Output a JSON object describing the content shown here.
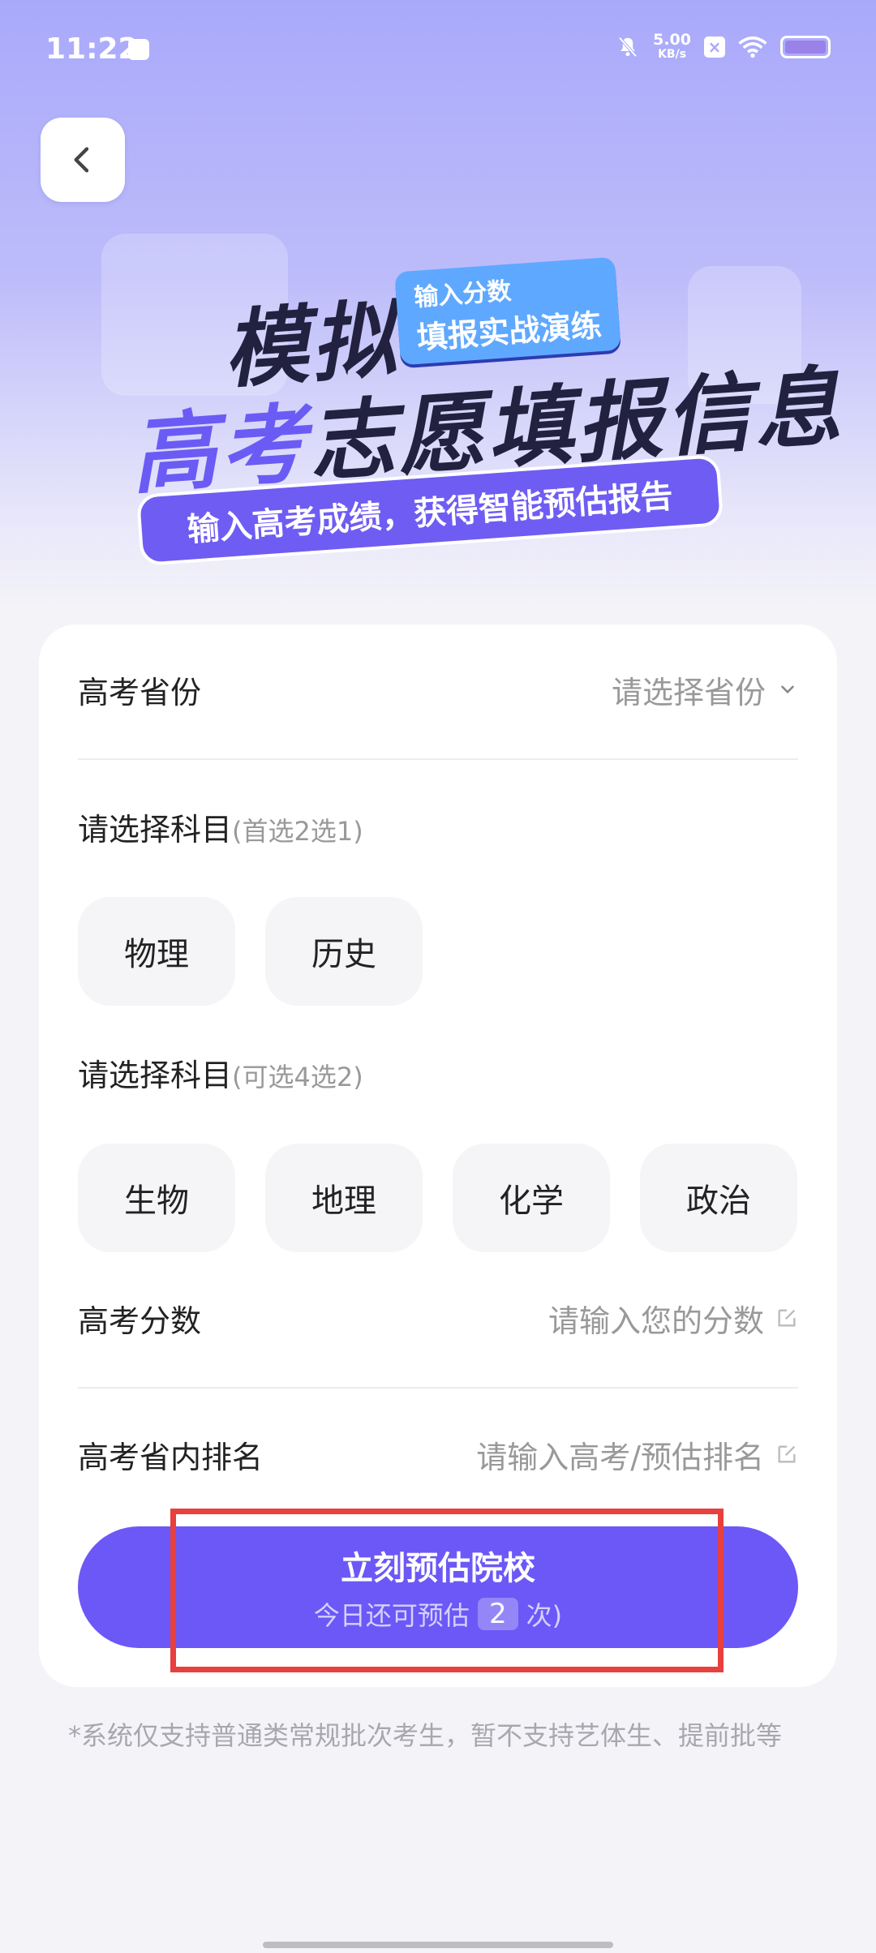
{
  "status_bar": {
    "time": "11:22",
    "net_speed_value": "5.00",
    "net_speed_unit": "KB/s",
    "icons": [
      "message-icon",
      "bell-muted-icon",
      "sim-off-icon",
      "wifi-icon",
      "battery-icon"
    ]
  },
  "banner": {
    "title_line1": "模拟",
    "tag_line1": "输入分数",
    "tag_line2": "填报实战演练",
    "title_line2_highlight": "高考",
    "title_line2_rest": "志愿填报信息",
    "subtitle": "输入高考成绩，获得智能预估报告"
  },
  "form": {
    "province": {
      "label": "高考省份",
      "placeholder": "请选择省份"
    },
    "primary_subjects": {
      "title": "请选择科目",
      "hint": "(首选2选1)",
      "options": [
        "物理",
        "历史"
      ]
    },
    "elective_subjects": {
      "title": "请选择科目",
      "hint": "(可选4选2)",
      "options": [
        "生物",
        "地理",
        "化学",
        "政治"
      ]
    },
    "score": {
      "label": "高考分数",
      "placeholder": "请输入您的分数"
    },
    "rank": {
      "label": "高考省内排名",
      "placeholder": "请输入高考/预估排名"
    },
    "submit": {
      "label": "立刻预估院校",
      "sub_prefix": "今日还可预估",
      "remaining": "2",
      "sub_suffix": "次)"
    }
  },
  "footnote": "*系统仅支持普通类常规批次考生，暂不支持艺体生、提前批等",
  "colors": {
    "accent": "#6c58f6",
    "highlight_box": "#e8403f"
  }
}
